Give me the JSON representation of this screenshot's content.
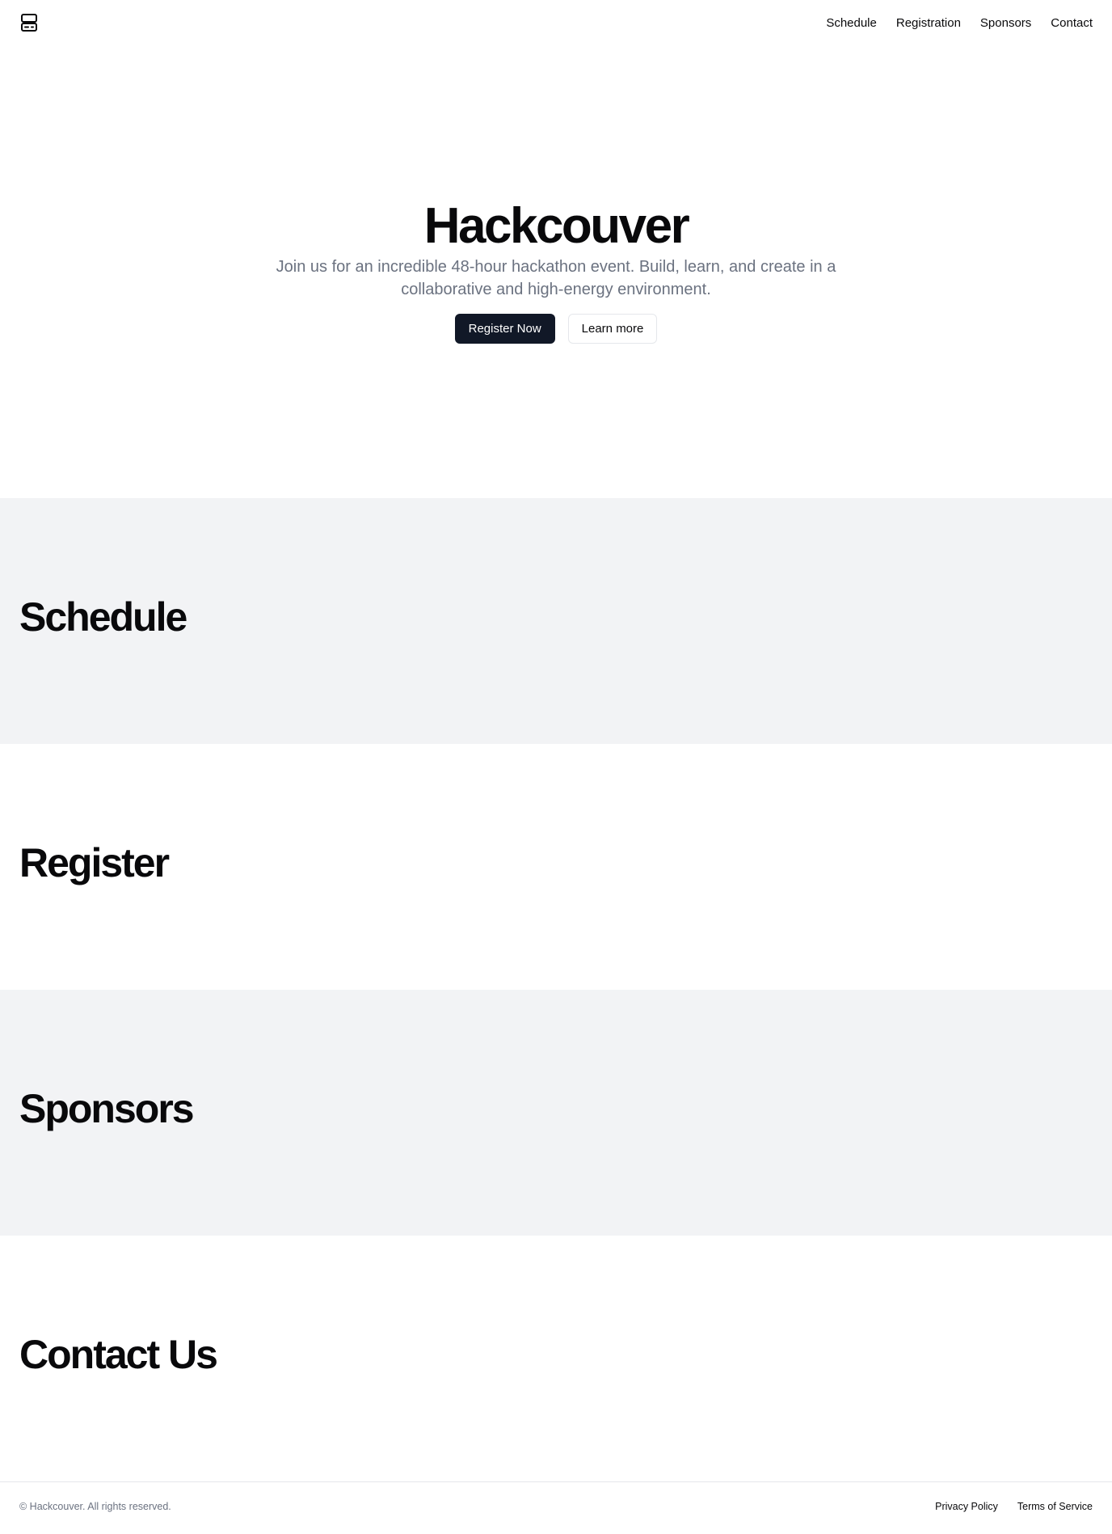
{
  "header": {
    "logo_icon": "server-icon",
    "nav": [
      {
        "label": "Schedule"
      },
      {
        "label": "Registration"
      },
      {
        "label": "Sponsors"
      },
      {
        "label": "Contact"
      }
    ]
  },
  "hero": {
    "title": "Hackcouver",
    "subtitle": "Join us for an incredible 48-hour hackathon event. Build, learn, and create in a collaborative and high-energy environment.",
    "primary_button": "Register Now",
    "secondary_button": "Learn more"
  },
  "sections": {
    "schedule": "Schedule",
    "register": "Register",
    "sponsors": "Sponsors",
    "contact": "Contact Us"
  },
  "footer": {
    "copyright": "© Hackcouver. All rights reserved.",
    "links": [
      {
        "label": "Privacy Policy"
      },
      {
        "label": "Terms of Service"
      }
    ]
  },
  "colors": {
    "primary_button_bg": "#111827",
    "section_gray_bg": "#f2f3f5",
    "muted_text": "#6b7280"
  }
}
